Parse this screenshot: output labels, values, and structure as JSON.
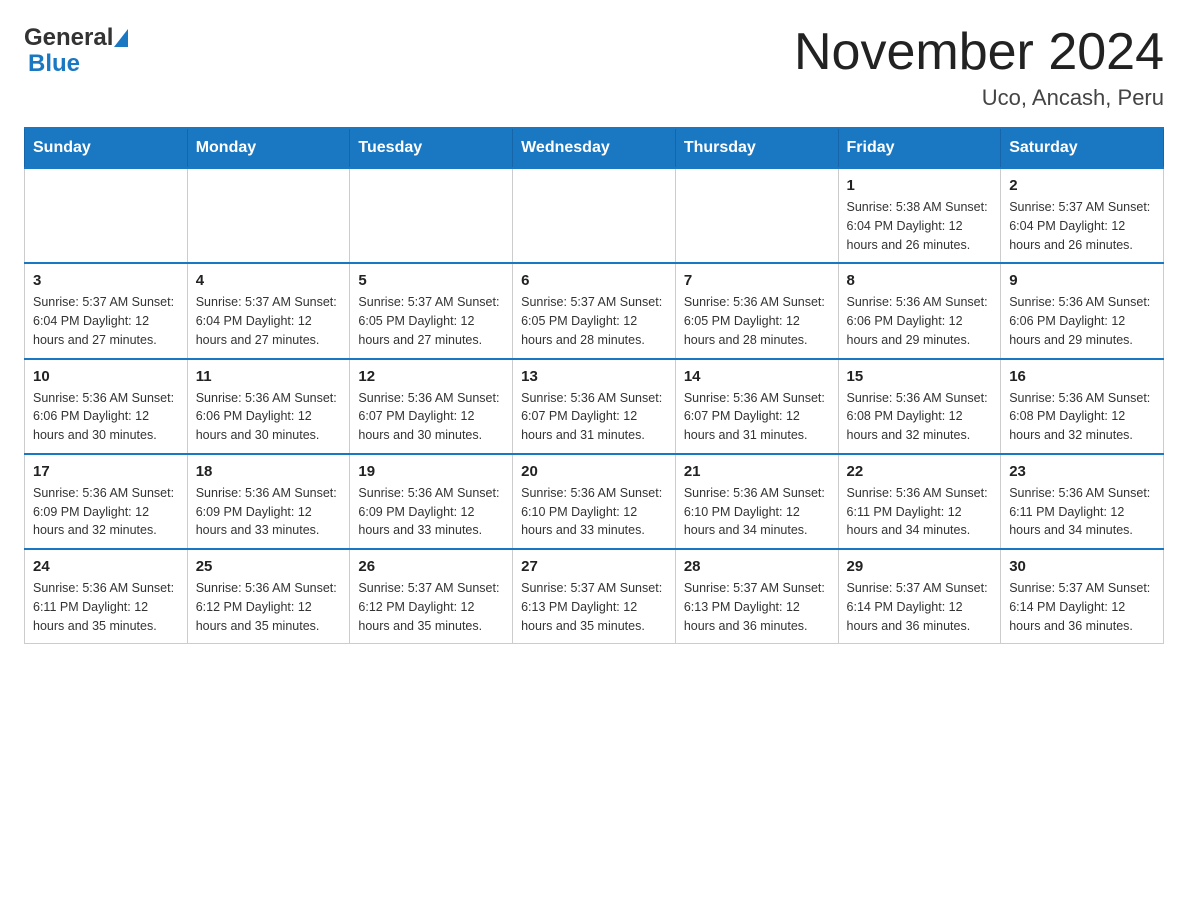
{
  "header": {
    "logo_text_general": "General",
    "logo_text_blue": "Blue",
    "month_year": "November 2024",
    "location": "Uco, Ancash, Peru"
  },
  "days_of_week": [
    "Sunday",
    "Monday",
    "Tuesday",
    "Wednesday",
    "Thursday",
    "Friday",
    "Saturday"
  ],
  "weeks": [
    [
      {
        "day": "",
        "info": ""
      },
      {
        "day": "",
        "info": ""
      },
      {
        "day": "",
        "info": ""
      },
      {
        "day": "",
        "info": ""
      },
      {
        "day": "",
        "info": ""
      },
      {
        "day": "1",
        "info": "Sunrise: 5:38 AM\nSunset: 6:04 PM\nDaylight: 12 hours and 26 minutes."
      },
      {
        "day": "2",
        "info": "Sunrise: 5:37 AM\nSunset: 6:04 PM\nDaylight: 12 hours and 26 minutes."
      }
    ],
    [
      {
        "day": "3",
        "info": "Sunrise: 5:37 AM\nSunset: 6:04 PM\nDaylight: 12 hours and 27 minutes."
      },
      {
        "day": "4",
        "info": "Sunrise: 5:37 AM\nSunset: 6:04 PM\nDaylight: 12 hours and 27 minutes."
      },
      {
        "day": "5",
        "info": "Sunrise: 5:37 AM\nSunset: 6:05 PM\nDaylight: 12 hours and 27 minutes."
      },
      {
        "day": "6",
        "info": "Sunrise: 5:37 AM\nSunset: 6:05 PM\nDaylight: 12 hours and 28 minutes."
      },
      {
        "day": "7",
        "info": "Sunrise: 5:36 AM\nSunset: 6:05 PM\nDaylight: 12 hours and 28 minutes."
      },
      {
        "day": "8",
        "info": "Sunrise: 5:36 AM\nSunset: 6:06 PM\nDaylight: 12 hours and 29 minutes."
      },
      {
        "day": "9",
        "info": "Sunrise: 5:36 AM\nSunset: 6:06 PM\nDaylight: 12 hours and 29 minutes."
      }
    ],
    [
      {
        "day": "10",
        "info": "Sunrise: 5:36 AM\nSunset: 6:06 PM\nDaylight: 12 hours and 30 minutes."
      },
      {
        "day": "11",
        "info": "Sunrise: 5:36 AM\nSunset: 6:06 PM\nDaylight: 12 hours and 30 minutes."
      },
      {
        "day": "12",
        "info": "Sunrise: 5:36 AM\nSunset: 6:07 PM\nDaylight: 12 hours and 30 minutes."
      },
      {
        "day": "13",
        "info": "Sunrise: 5:36 AM\nSunset: 6:07 PM\nDaylight: 12 hours and 31 minutes."
      },
      {
        "day": "14",
        "info": "Sunrise: 5:36 AM\nSunset: 6:07 PM\nDaylight: 12 hours and 31 minutes."
      },
      {
        "day": "15",
        "info": "Sunrise: 5:36 AM\nSunset: 6:08 PM\nDaylight: 12 hours and 32 minutes."
      },
      {
        "day": "16",
        "info": "Sunrise: 5:36 AM\nSunset: 6:08 PM\nDaylight: 12 hours and 32 minutes."
      }
    ],
    [
      {
        "day": "17",
        "info": "Sunrise: 5:36 AM\nSunset: 6:09 PM\nDaylight: 12 hours and 32 minutes."
      },
      {
        "day": "18",
        "info": "Sunrise: 5:36 AM\nSunset: 6:09 PM\nDaylight: 12 hours and 33 minutes."
      },
      {
        "day": "19",
        "info": "Sunrise: 5:36 AM\nSunset: 6:09 PM\nDaylight: 12 hours and 33 minutes."
      },
      {
        "day": "20",
        "info": "Sunrise: 5:36 AM\nSunset: 6:10 PM\nDaylight: 12 hours and 33 minutes."
      },
      {
        "day": "21",
        "info": "Sunrise: 5:36 AM\nSunset: 6:10 PM\nDaylight: 12 hours and 34 minutes."
      },
      {
        "day": "22",
        "info": "Sunrise: 5:36 AM\nSunset: 6:11 PM\nDaylight: 12 hours and 34 minutes."
      },
      {
        "day": "23",
        "info": "Sunrise: 5:36 AM\nSunset: 6:11 PM\nDaylight: 12 hours and 34 minutes."
      }
    ],
    [
      {
        "day": "24",
        "info": "Sunrise: 5:36 AM\nSunset: 6:11 PM\nDaylight: 12 hours and 35 minutes."
      },
      {
        "day": "25",
        "info": "Sunrise: 5:36 AM\nSunset: 6:12 PM\nDaylight: 12 hours and 35 minutes."
      },
      {
        "day": "26",
        "info": "Sunrise: 5:37 AM\nSunset: 6:12 PM\nDaylight: 12 hours and 35 minutes."
      },
      {
        "day": "27",
        "info": "Sunrise: 5:37 AM\nSunset: 6:13 PM\nDaylight: 12 hours and 35 minutes."
      },
      {
        "day": "28",
        "info": "Sunrise: 5:37 AM\nSunset: 6:13 PM\nDaylight: 12 hours and 36 minutes."
      },
      {
        "day": "29",
        "info": "Sunrise: 5:37 AM\nSunset: 6:14 PM\nDaylight: 12 hours and 36 minutes."
      },
      {
        "day": "30",
        "info": "Sunrise: 5:37 AM\nSunset: 6:14 PM\nDaylight: 12 hours and 36 minutes."
      }
    ]
  ]
}
